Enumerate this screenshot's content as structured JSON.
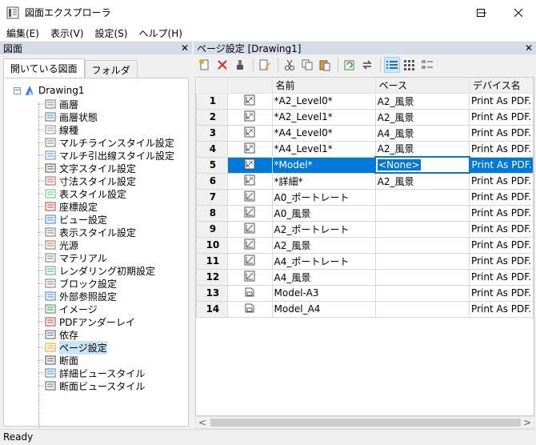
{
  "window": {
    "title": "図面エクスプローラ"
  },
  "menu": [
    "編集(E)",
    "表示(V)",
    "設定(S)",
    "ヘルプ(H)"
  ],
  "left_pane": {
    "title": "図面",
    "tabs": [
      "開いている図面",
      "フォルダ"
    ],
    "root": "Drawing1",
    "items": [
      {
        "label": "画層",
        "icon": "layer-icon"
      },
      {
        "label": "画層状態",
        "icon": "layer-state-icon"
      },
      {
        "label": "線種",
        "icon": "linetype-icon"
      },
      {
        "label": "マルチラインスタイル設定",
        "icon": "multiline-style-icon"
      },
      {
        "label": "マルチ引出線スタイル設定",
        "icon": "multileader-style-icon"
      },
      {
        "label": "文字スタイル設定",
        "icon": "text-style-icon"
      },
      {
        "label": "寸法スタイル設定",
        "icon": "dimension-style-icon"
      },
      {
        "label": "表スタイル設定",
        "icon": "table-style-icon"
      },
      {
        "label": "座標設定",
        "icon": "coordinate-icon"
      },
      {
        "label": "ビュー設定",
        "icon": "view-icon"
      },
      {
        "label": "表示スタイル設定",
        "icon": "visual-style-icon"
      },
      {
        "label": "光源",
        "icon": "light-icon"
      },
      {
        "label": "マテリアル",
        "icon": "material-icon"
      },
      {
        "label": "レンダリング初期設定",
        "icon": "render-icon"
      },
      {
        "label": "ブロック設定",
        "icon": "block-icon"
      },
      {
        "label": "外部参照設定",
        "icon": "xref-icon"
      },
      {
        "label": "イメージ",
        "icon": "image-icon"
      },
      {
        "label": "PDFアンダーレイ",
        "icon": "pdf-icon"
      },
      {
        "label": "依存",
        "icon": "dependency-icon"
      },
      {
        "label": "ページ設定",
        "icon": "page-setup-icon"
      },
      {
        "label": "断面",
        "icon": "section-icon"
      },
      {
        "label": "詳細ビュースタイル",
        "icon": "detail-view-icon"
      },
      {
        "label": "断面ビュースタイル",
        "icon": "section-view-icon"
      }
    ]
  },
  "right_pane": {
    "title": "ページ設定 [Drawing1]",
    "columns": [
      "名前",
      "ベース",
      "デバイス名"
    ],
    "rows": [
      {
        "n": "1",
        "name": "*A2_Level0*",
        "base": "A2_風景",
        "device": "Print As PDF.",
        "icon": "layout-icon"
      },
      {
        "n": "2",
        "name": "*A2_Level1*",
        "base": "A2_風景",
        "device": "Print As PDF.",
        "icon": "layout-icon"
      },
      {
        "n": "3",
        "name": "*A4_Level0*",
        "base": "A4_風景",
        "device": "Print As PDF.",
        "icon": "layout-icon"
      },
      {
        "n": "4",
        "name": "*A4_Level1*",
        "base": "A2_風景",
        "device": "Print As PDF.",
        "icon": "layout-icon"
      },
      {
        "n": "5",
        "name": "*Model*",
        "base": "<None>",
        "device": "Print As PDF.",
        "icon": "layout-icon"
      },
      {
        "n": "6",
        "name": "*詳細*",
        "base": "A2_風景",
        "device": "Print As PDF.",
        "icon": "layout-icon"
      },
      {
        "n": "7",
        "name": "A0_ポートレート",
        "base": "",
        "device": "Print As PDF.",
        "icon": "page-icon"
      },
      {
        "n": "8",
        "name": "A0_風景",
        "base": "",
        "device": "Print As PDF.",
        "icon": "page-icon"
      },
      {
        "n": "9",
        "name": "A2_ポートレート",
        "base": "",
        "device": "Print As PDF.",
        "icon": "page-icon"
      },
      {
        "n": "10",
        "name": "A2_風景",
        "base": "",
        "device": "Print As PDF.",
        "icon": "page-icon"
      },
      {
        "n": "11",
        "name": "A4_ポートレート",
        "base": "",
        "device": "Print As PDF.",
        "icon": "page-icon"
      },
      {
        "n": "12",
        "name": "A4_風景",
        "base": "",
        "device": "Print As PDF.",
        "icon": "page-icon"
      },
      {
        "n": "13",
        "name": "Model-A3",
        "base": "",
        "device": "Print As PDF.",
        "icon": "model-icon"
      },
      {
        "n": "14",
        "name": "Model_A4",
        "base": "",
        "device": "Print As PDF.",
        "icon": "model-icon"
      }
    ],
    "selected_row": 5
  },
  "status": {
    "text": "Ready"
  },
  "colors": {
    "selection": "#0078d7",
    "header_bg": "#d6dbe9"
  }
}
